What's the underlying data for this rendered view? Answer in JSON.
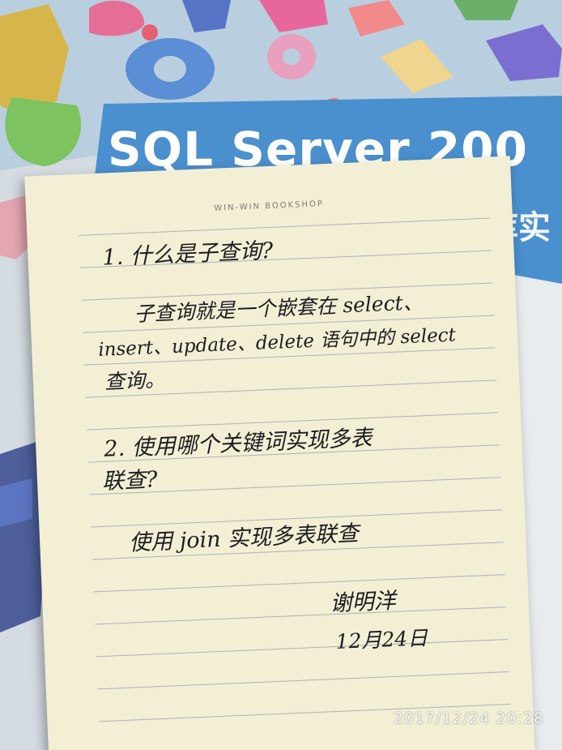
{
  "book": {
    "title": "SQL Server 200",
    "subtitle": "据库实"
  },
  "notebook": {
    "brand": "WIN-WIN BOOKSHOP",
    "question1": "1. 什么是子查询?",
    "answer1_line1": "子查询就是一个嵌套在 select、",
    "answer1_line2": "insert、update、delete 语句中的 select",
    "answer1_line3": "查询。",
    "question2_line1": "2. 使用哪个关键词实现多表",
    "question2_line2": "联查?",
    "answer2": "使用 join 实现多表联查",
    "signature_name": "谢明洋",
    "signature_date": "12月24日"
  },
  "photo_timestamp": "2017/12/24  20:28",
  "colors": {
    "book_cover_blue": "#4a8fce",
    "paper": "#f3efd4",
    "ink": "#1d1c21",
    "red_mark": "#e0182c"
  }
}
